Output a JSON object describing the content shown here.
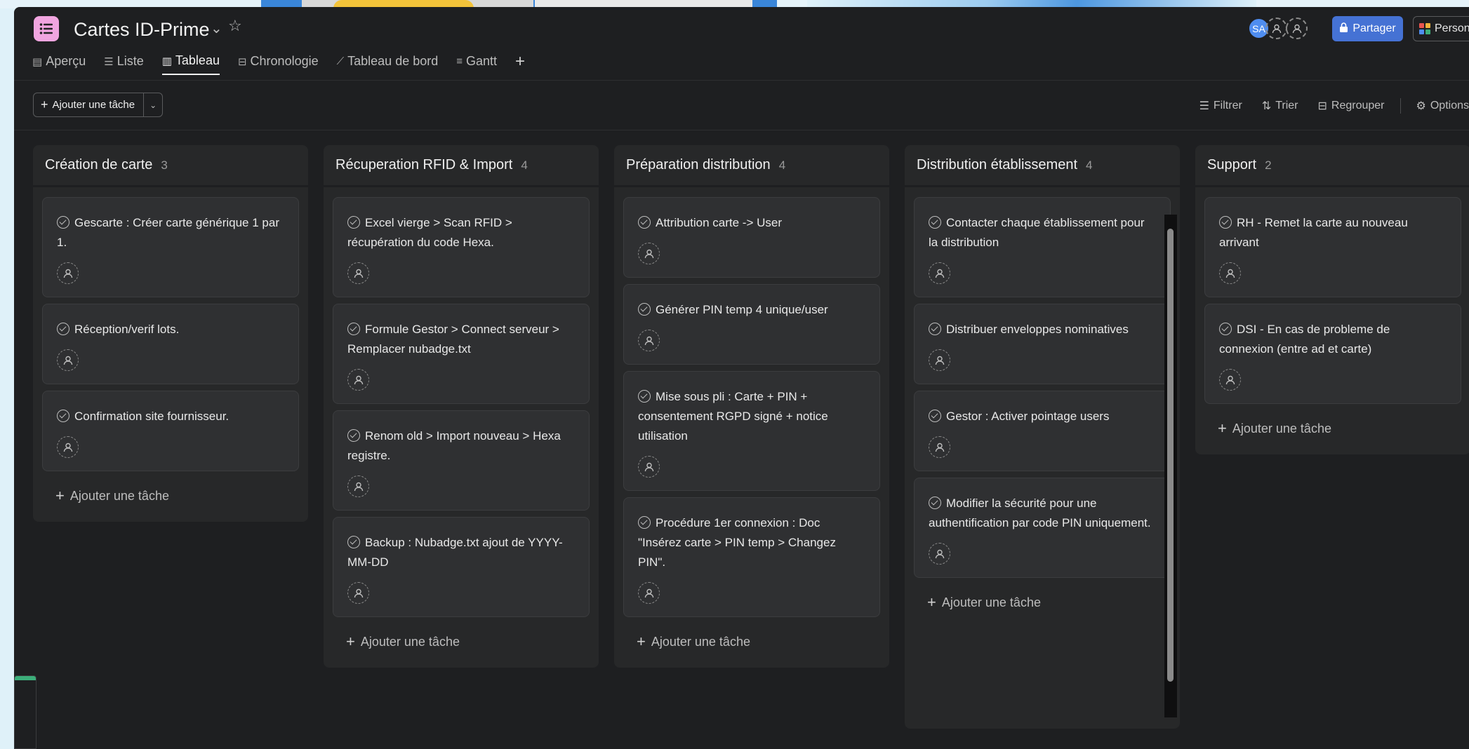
{
  "project": {
    "title": "Cartes ID-Prime",
    "icon": "list-icon",
    "icon_color": "#f1a5e0"
  },
  "tabs": [
    {
      "label": "Aperçu",
      "icon": "overview-icon"
    },
    {
      "label": "Liste",
      "icon": "list-icon"
    },
    {
      "label": "Tableau",
      "icon": "board-icon",
      "active": true
    },
    {
      "label": "Chronologie",
      "icon": "timeline-icon"
    },
    {
      "label": "Tableau de bord",
      "icon": "dashboard-icon"
    },
    {
      "label": "Gantt",
      "icon": "gantt-icon"
    }
  ],
  "header_right": {
    "avatar_initials": "SA",
    "share_label": "Partager",
    "customize_label": "Personnaliser",
    "accent": "#4572d4"
  },
  "toolbar": {
    "add_task_label": "Ajouter une tâche",
    "filter_label": "Filtrer",
    "sort_label": "Trier",
    "group_label": "Regrouper",
    "options_label": "Options"
  },
  "columns": [
    {
      "name": "Création de carte",
      "count": "3",
      "add_label": "Ajouter une tâche",
      "cards": [
        {
          "title": "Gescarte : Créer carte générique 1 par 1."
        },
        {
          "title": "Réception/verif lots."
        },
        {
          "title": "Confirmation site fournisseur."
        }
      ]
    },
    {
      "name": "Récuperation RFID & Import",
      "count": "4",
      "add_label": "Ajouter une tâche",
      "cards": [
        {
          "title": "Excel vierge > Scan RFID > récupération du code Hexa."
        },
        {
          "title": "Formule Gestor > Connect serveur > Remplacer nubadge.txt"
        },
        {
          "title": "Renom old > Import nouveau > Hexa registre."
        },
        {
          "title": "Backup : Nubadge.txt ajout de YYYY-MM-DD"
        }
      ]
    },
    {
      "name": "Préparation distribution",
      "count": "4",
      "add_label": "Ajouter une tâche",
      "cards": [
        {
          "title": "Attribution carte -> User"
        },
        {
          "title": "Générer PIN temp 4 unique/user"
        },
        {
          "title": "Mise sous pli : Carte + PIN + consentement RGPD signé + notice utilisation"
        },
        {
          "title": "Procédure 1er connexion : Doc \"Insérez carte > PIN temp > Changez PIN\"."
        }
      ]
    },
    {
      "name": "Distribution établissement",
      "count": "4",
      "add_label": "Ajouter une tâche",
      "cards": [
        {
          "title": "Contacter chaque établissement pour la distribution"
        },
        {
          "title": "Distribuer enveloppes nominatives"
        },
        {
          "title": "Gestor : Activer pointage users"
        },
        {
          "title": "Modifier la sécurité pour une authentification par code PIN uniquement."
        }
      ]
    },
    {
      "name": "Support",
      "count": "2",
      "add_label": "Ajouter une tâche",
      "cards": [
        {
          "title": "RH - Remet la carte au nouveau arrivant"
        },
        {
          "title": "DSI - En cas de probleme de connexion (entre ad et carte)"
        }
      ]
    }
  ]
}
